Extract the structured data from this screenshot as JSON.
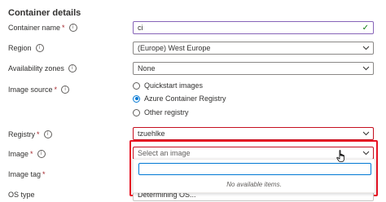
{
  "section": {
    "title": "Container details"
  },
  "container_name": {
    "label": "Container name",
    "required": "*",
    "value": "ci"
  },
  "region": {
    "label": "Region",
    "value": "(Europe) West Europe"
  },
  "availability_zones": {
    "label": "Availability zones",
    "value": "None"
  },
  "image_source": {
    "label": "Image source",
    "required": "*",
    "options": [
      {
        "label": "Quickstart images",
        "selected": false
      },
      {
        "label": "Azure Container Registry",
        "selected": true
      },
      {
        "label": "Other registry",
        "selected": false
      }
    ]
  },
  "registry": {
    "label": "Registry",
    "required": "*",
    "value": "tzuehlke"
  },
  "image": {
    "label": "Image",
    "required": "*",
    "placeholder": "Select an image",
    "dropdown": {
      "filter_value": "",
      "empty_text": "No available items."
    }
  },
  "image_tag": {
    "label": "Image tag",
    "required": "*"
  },
  "os_type": {
    "label": "OS type",
    "value": "Determining OS..."
  },
  "icons": {
    "info": "info-icon",
    "chevron": "chevron-down-icon",
    "check": "checkmark-icon",
    "cursor": "hand-pointer-icon"
  },
  "colors": {
    "accent": "#0078d4",
    "error_border": "#c50f1f",
    "highlight": "#e81123",
    "valid": "#107c10"
  }
}
